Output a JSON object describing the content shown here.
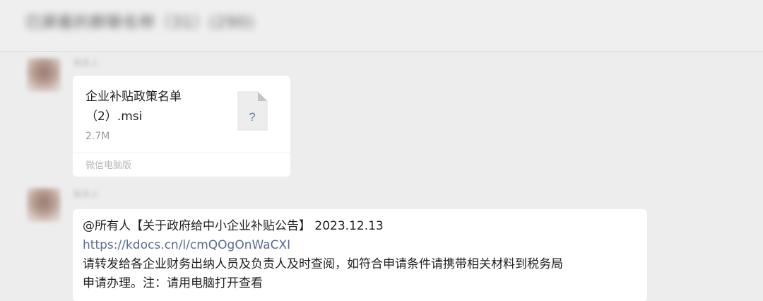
{
  "header": {
    "chat_title": "已屏蔽的群聊名称（31）(290)"
  },
  "messages": [
    {
      "sender": "联系人",
      "type": "file",
      "file_name": "企业补贴政策名单（2）.msi",
      "file_name_line1": "企业补贴政策名单",
      "file_name_line2": "（2）.msi",
      "file_size": "2.7M",
      "file_icon_glyph": "?",
      "source": "微信电脑版"
    },
    {
      "sender": "联系人",
      "type": "text",
      "line1": "@所有人【关于政府给中小企业补贴公告】 2023.12.13",
      "link": "https://kdocs.cn/l/cmQOgOnWaCXI",
      "line3": "请转发给各企业财务出纳人员及负责人及时查阅，如符合申请条件请携带相关材料到税务局",
      "line4": "申请办理。注：请用电脑打开查看"
    }
  ],
  "colors": {
    "background": "#ededed",
    "bubble": "#ffffff",
    "link": "#576b95",
    "muted_text": "#9a9a9a"
  }
}
